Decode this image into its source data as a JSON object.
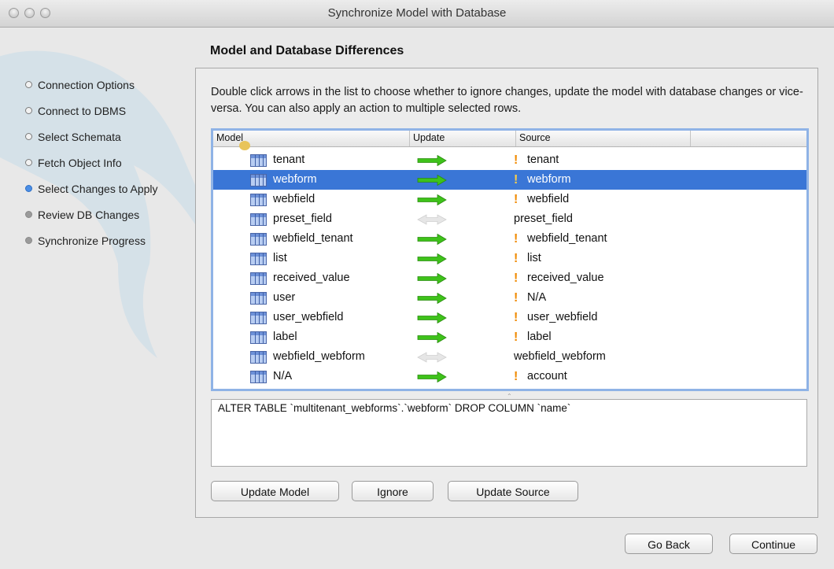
{
  "window": {
    "title": "Synchronize Model with Database"
  },
  "steps": [
    {
      "label": "Connection Options",
      "state": "done"
    },
    {
      "label": "Connect to DBMS",
      "state": "done"
    },
    {
      "label": "Select Schemata",
      "state": "done"
    },
    {
      "label": "Fetch Object Info",
      "state": "done"
    },
    {
      "label": "Select Changes to Apply",
      "state": "current"
    },
    {
      "label": "Review DB Changes",
      "state": "pending"
    },
    {
      "label": "Synchronize Progress",
      "state": "pending"
    }
  ],
  "page": {
    "heading": "Model and Database Differences",
    "description": "Double click arrows in the list to choose whether to ignore changes, update the model with database changes or vice-versa. You can also apply an action to multiple selected rows."
  },
  "grid": {
    "columns": [
      "Model",
      "Update",
      "Source"
    ],
    "rows": [
      {
        "model": "tenant",
        "action": "update-source",
        "source": "tenant",
        "changed": true,
        "selected": false
      },
      {
        "model": "webform",
        "action": "update-source",
        "source": "webform",
        "changed": true,
        "selected": true
      },
      {
        "model": "webfield",
        "action": "update-source",
        "source": "webfield",
        "changed": true,
        "selected": false
      },
      {
        "model": "preset_field",
        "action": "ignore",
        "source": "preset_field",
        "changed": false,
        "selected": false
      },
      {
        "model": "webfield_tenant",
        "action": "update-source",
        "source": "webfield_tenant",
        "changed": true,
        "selected": false
      },
      {
        "model": "list",
        "action": "update-source",
        "source": "list",
        "changed": true,
        "selected": false
      },
      {
        "model": "received_value",
        "action": "update-source",
        "source": "received_value",
        "changed": true,
        "selected": false
      },
      {
        "model": "user",
        "action": "update-source",
        "source": "N/A",
        "changed": true,
        "selected": false
      },
      {
        "model": "user_webfield",
        "action": "update-source",
        "source": "user_webfield",
        "changed": true,
        "selected": false
      },
      {
        "model": "label",
        "action": "update-source",
        "source": "label",
        "changed": true,
        "selected": false
      },
      {
        "model": "webfield_webform",
        "action": "ignore",
        "source": "webfield_webform",
        "changed": false,
        "selected": false
      },
      {
        "model": "N/A",
        "action": "update-source",
        "source": "account",
        "changed": true,
        "selected": false
      }
    ],
    "warn_glyph": "!"
  },
  "sql": {
    "text": "ALTER TABLE `multitenant_webforms`.`webform` DROP COLUMN `name`"
  },
  "actions": {
    "update_model": "Update Model",
    "ignore": "Ignore",
    "update_source": "Update Source"
  },
  "footer": {
    "back": "Go Back",
    "continue": "Continue"
  },
  "colors": {
    "arrow_active": "#3ec21a",
    "arrow_inactive": "#e6e6e6",
    "selection": "#3a76d6",
    "warn": "#f08a00",
    "current_step": "#4a8ee6"
  },
  "icons": {
    "table": "table-icon",
    "arrow": "arrow-right-icon",
    "warning": "warning-icon"
  }
}
